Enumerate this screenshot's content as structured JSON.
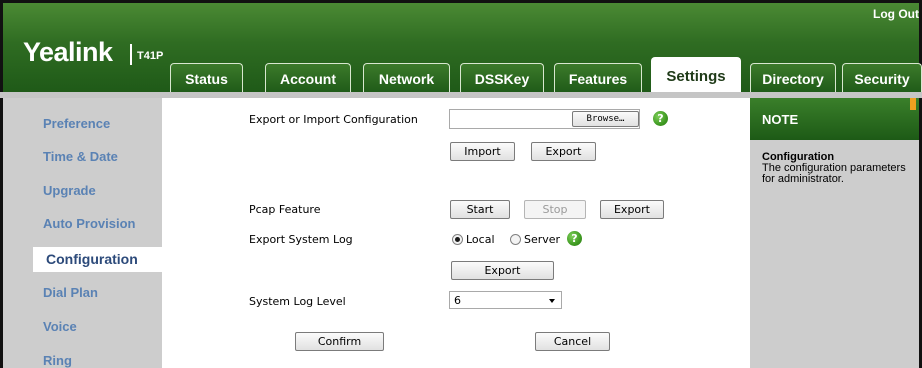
{
  "header": {
    "brand": "Yealink",
    "model": "T41P",
    "logout_label": "Log Out"
  },
  "tabs": [
    {
      "label": "Status"
    },
    {
      "label": "Account"
    },
    {
      "label": "Network"
    },
    {
      "label": "DSSKey"
    },
    {
      "label": "Features"
    },
    {
      "label": "Settings",
      "active": true
    },
    {
      "label": "Directory"
    },
    {
      "label": "Security"
    }
  ],
  "sidebar": {
    "items": [
      {
        "label": "Preference"
      },
      {
        "label": "Time & Date"
      },
      {
        "label": "Upgrade"
      },
      {
        "label": "Auto Provision"
      },
      {
        "label": "Configuration",
        "active": true
      },
      {
        "label": "Dial Plan"
      },
      {
        "label": "Voice"
      },
      {
        "label": "Ring"
      }
    ]
  },
  "config": {
    "export_import_label": "Export or Import Configuration",
    "file_value": "",
    "browse_label": "Browse…",
    "import_label": "Import",
    "export_label": "Export",
    "pcap_label": "Pcap Feature",
    "pcap_start_label": "Start",
    "pcap_stop_label": "Stop",
    "pcap_export_label": "Export",
    "syslog_label": "Export System Log",
    "syslog_local_label": "Local",
    "syslog_server_label": "Server",
    "syslog_selected": "Local",
    "syslog_export_label": "Export",
    "loglevel_label": "System Log Level",
    "loglevel_value": "6",
    "confirm_label": "Confirm",
    "cancel_label": "Cancel",
    "help_glyph": "?"
  },
  "note": {
    "title": "NOTE",
    "heading": "Configuration",
    "text": "The configuration parameters for administrator."
  },
  "colors": {
    "header_green": "#2f6c22",
    "sidebar_link": "#5a82b4",
    "panel_gray": "#cdcdcd",
    "help_green": "#3f9a22"
  }
}
